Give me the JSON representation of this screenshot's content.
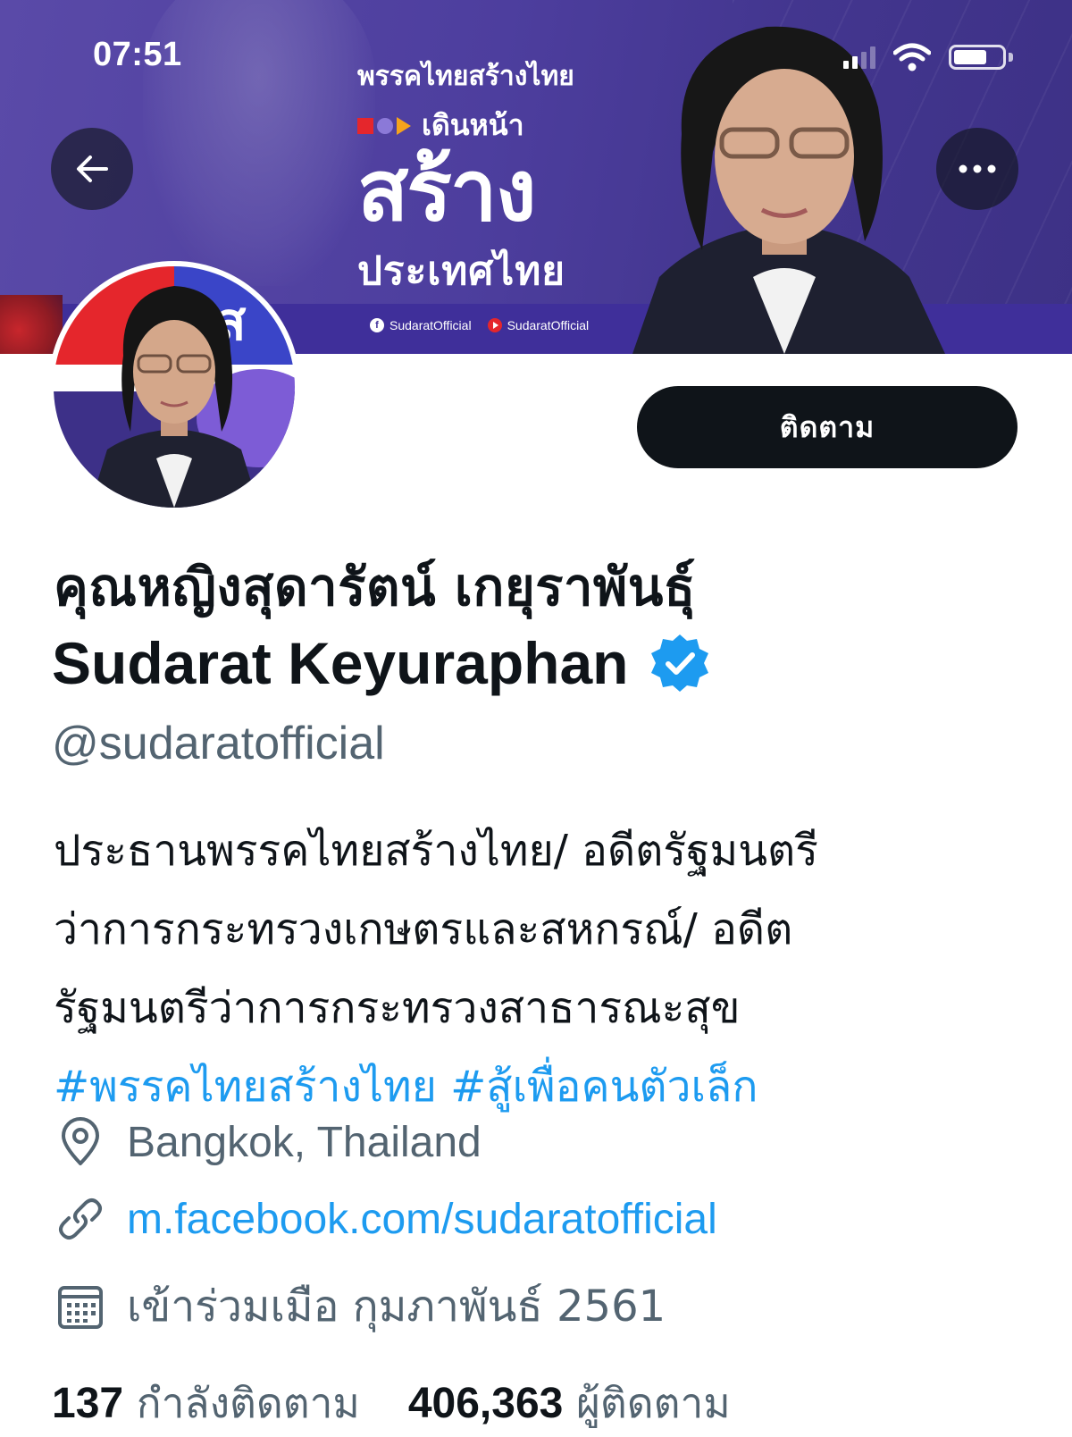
{
  "status_bar": {
    "time": "07:51"
  },
  "banner": {
    "campaign_line1": "พรรคไทยสร้างไทย",
    "campaign_line2": "เดินหน้า",
    "campaign_line3": "สร้าง",
    "campaign_line4": "ประเทศไทย",
    "social_facebook": "SudaratOfficial",
    "social_youtube": "SudaratOfficial",
    "colors": {
      "background": "#4d3e9e",
      "strip": "#3f2f9a",
      "accent_red": "#e5262c"
    }
  },
  "profile": {
    "avatar_logo_char": "ส",
    "follow_button_label": "ติดตาม",
    "name_thai": "คุณหญิงสุดารัตน์ เกยุราพันธุ์",
    "name_english": "Sudarat Keyuraphan",
    "verified_icon": "verified-badge-icon",
    "handle": "@sudaratofficial",
    "bio_lines": [
      "ประธานพรรคไทยสร้างไทย/ อดีตรัฐมนตรี",
      "ว่าการกระทรวงเกษตรและสหกรณ์/ อดีต",
      "รัฐมนตรีว่าการกระทรวงสาธารณะสุข"
    ],
    "hashtags": "#พรรคไทยสร้างไทย #สู้เพื่อคนตัวเล็ก",
    "location": "Bangkok, Thailand",
    "website": "m.facebook.com/sudaratofficial",
    "joined": "เข้าร่วมเมือ กุมภาพันธ์ 2561",
    "following_count": "137",
    "following_label": "กำลังติดตาม",
    "followers_count": "406,363",
    "followers_label": "ผู้ติดตาม",
    "colors": {
      "link": "#1d9bf0",
      "muted": "#536471",
      "text": "#0f1419"
    }
  }
}
